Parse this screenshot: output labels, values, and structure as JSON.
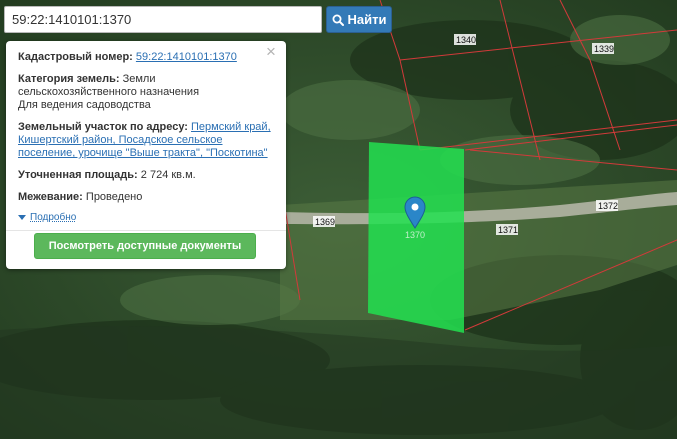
{
  "search": {
    "value": "59:22:1410101:1370",
    "button_label": "Найти"
  },
  "popup": {
    "cadastral_label": "Кадастровый номер:",
    "cadastral_value": "59:22:1410101:1370",
    "category_label": "Категория земель:",
    "category_value": "Земли сельскохозяйственного назначения",
    "category_use": "Для ведения садоводства",
    "address_label": "Земельный участок по адресу:",
    "address_value": "Пермский край, Кишертский район, Посадское сельское поселение, урочище \"Выше тракта\", \"Поскотина\"",
    "area_label": "Уточненная площадь:",
    "area_value": "2 724 кв.м.",
    "survey_label": "Межевание:",
    "survey_value": "Проведено",
    "details_label": "Подробно",
    "docs_button_label": "Посмотреть доступные документы"
  },
  "map": {
    "parcel_labels": [
      "1340",
      "1339",
      "1369",
      "1370",
      "1371",
      "1372"
    ],
    "parcel_color": "#22e050",
    "boundary_color": "#d23a3a",
    "marker_color": "#2a86c8"
  }
}
